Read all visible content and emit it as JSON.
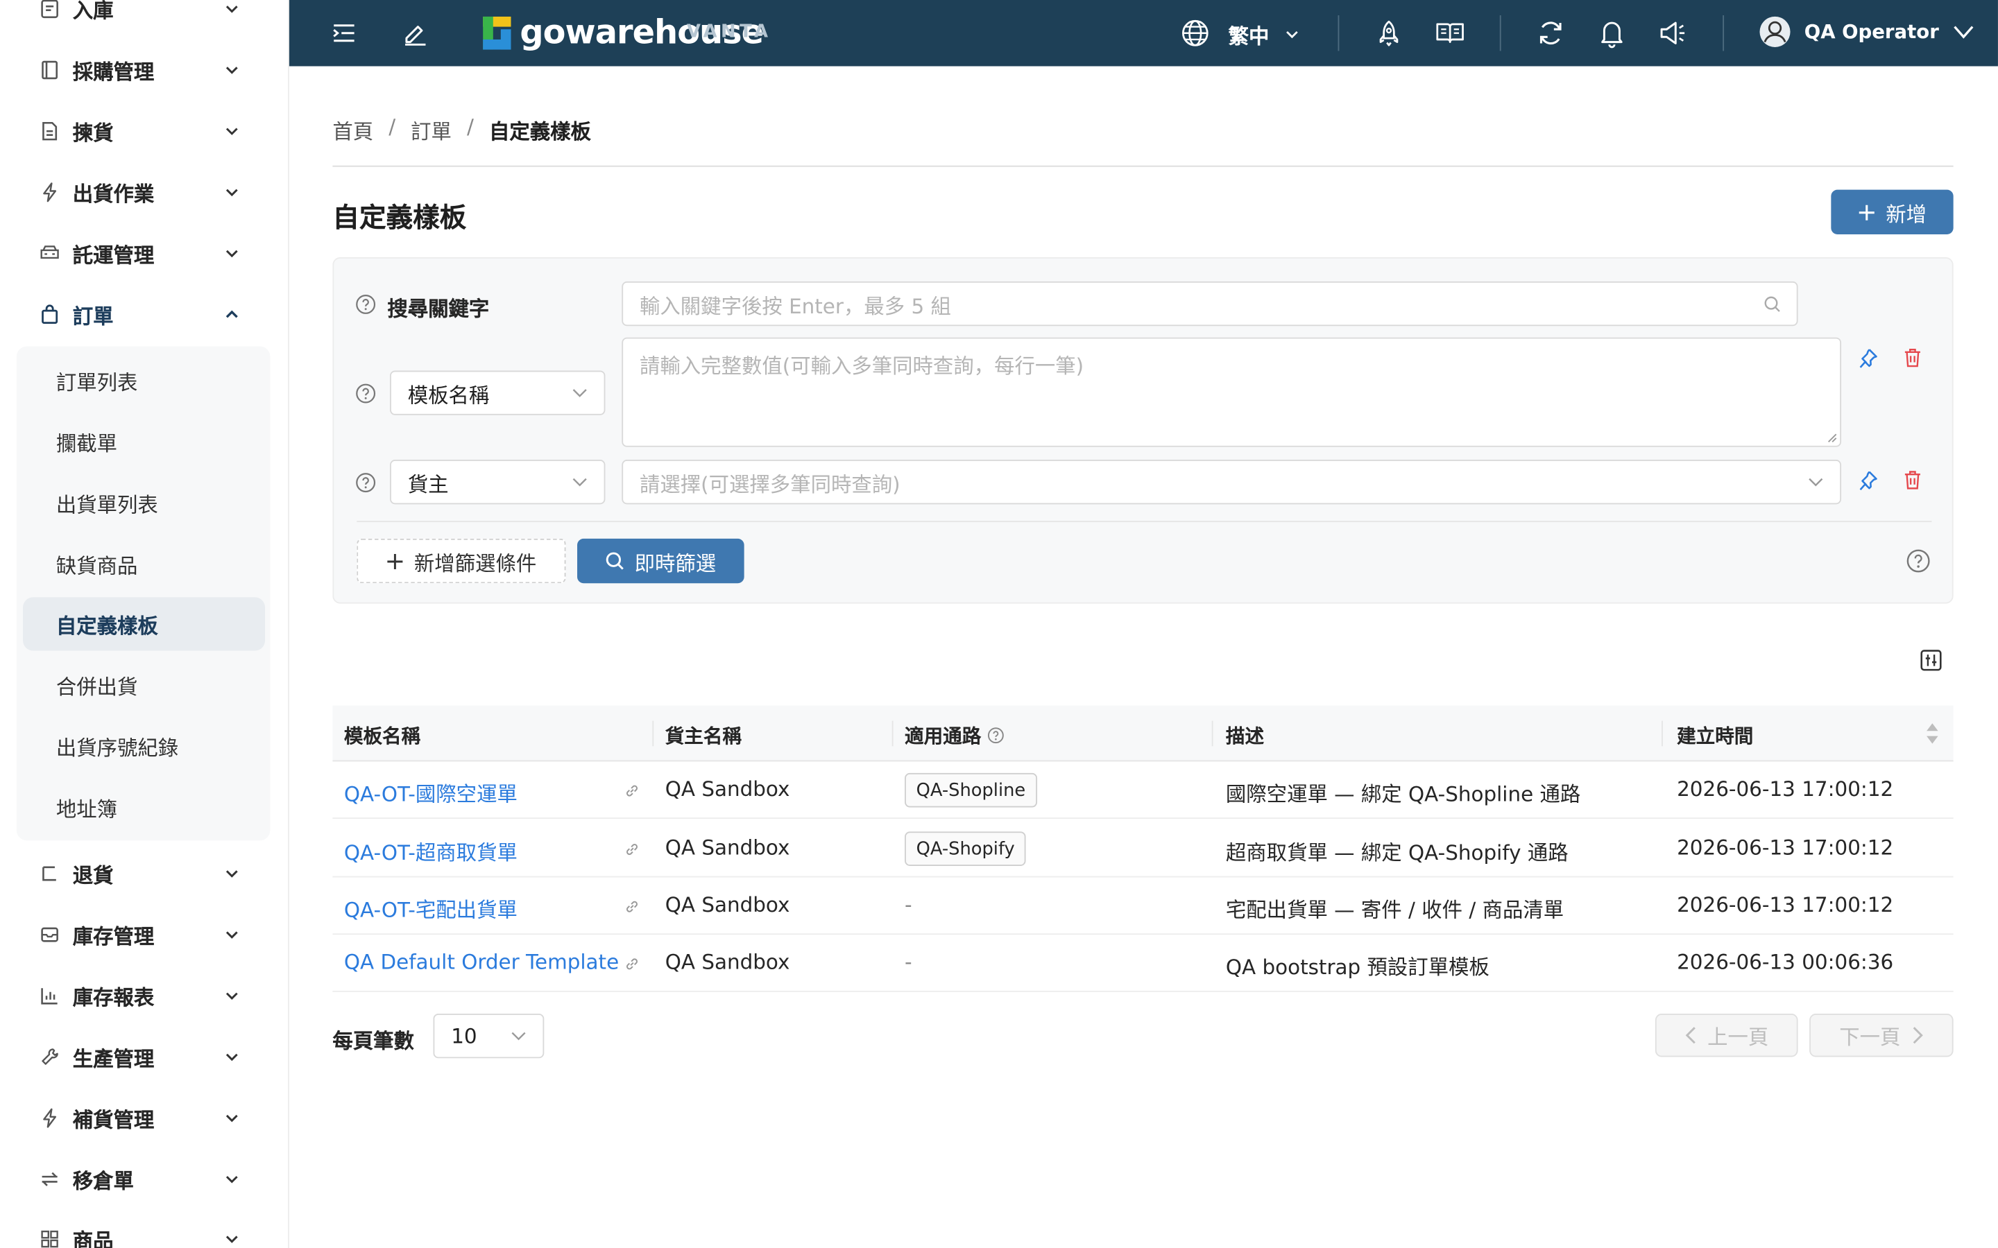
{
  "sidebar": {
    "items": [
      {
        "label": "入庫",
        "icon": "inbound-icon"
      },
      {
        "label": "採購管理",
        "icon": "document-icon"
      },
      {
        "label": "揀貨",
        "icon": "file-list-icon"
      },
      {
        "label": "出貨作業",
        "icon": "lightning-icon"
      },
      {
        "label": "託運管理",
        "icon": "truck-icon"
      },
      {
        "label": "訂單",
        "icon": "shopping-bag-icon"
      },
      {
        "label": "退貨",
        "icon": "return-icon"
      },
      {
        "label": "庫存管理",
        "icon": "inbox-icon"
      },
      {
        "label": "庫存報表",
        "icon": "bar-chart-icon"
      },
      {
        "label": "生產管理",
        "icon": "wrench-icon"
      },
      {
        "label": "補貨管理",
        "icon": "lightning-icon"
      },
      {
        "label": "移倉單",
        "icon": "swap-icon"
      },
      {
        "label": "商品",
        "icon": "grid-icon"
      }
    ],
    "order_submenu": [
      "訂單列表",
      "攔截單",
      "出貨單列表",
      "缺貨商品",
      "自定義樣板",
      "合併出貨",
      "出貨序號紀錄",
      "地址簿"
    ]
  },
  "topbar": {
    "logo_text": "gowarehouse",
    "logo_sub": "VANTA",
    "language": "繁中",
    "user_name": "QA Operator",
    "colors": {
      "bar": "#1e4057",
      "logo_yellow": "#f2c31a",
      "logo_green": "#39b54a",
      "logo_blue": "#2a8fd8"
    }
  },
  "breadcrumb": [
    "首頁",
    "訂單",
    "自定義樣板"
  ],
  "page": {
    "title": "自定義樣板",
    "add_button": "新增"
  },
  "filters": {
    "keyword_label": "搜尋關鍵字",
    "keyword_placeholder": "輸入關鍵字後按 Enter，最多 5 組",
    "field1_select": "模板名稱",
    "field1_placeholder": "請輸入完整數值(可輸入多筆同時查詢，每行一筆)",
    "field2_select": "貨主",
    "field2_placeholder": "請選擇(可選擇多筆同時查詢)",
    "add_condition": "新增篩選條件",
    "instant_filter": "即時篩選"
  },
  "table": {
    "headers": [
      "模板名稱",
      "貨主名稱",
      "適用通路",
      "描述",
      "建立時間"
    ],
    "rows": [
      {
        "name": "QA-OT-國際空運單",
        "owner": "QA Sandbox",
        "channel": "QA-Shopline",
        "desc": "國際空運單 — 綁定 QA-Shopline 通路",
        "created": "2026-06-13 17:00:12"
      },
      {
        "name": "QA-OT-超商取貨單",
        "owner": "QA Sandbox",
        "channel": "QA-Shopify",
        "desc": "超商取貨單 — 綁定 QA-Shopify 通路",
        "created": "2026-06-13 17:00:12"
      },
      {
        "name": "QA-OT-宅配出貨單",
        "owner": "QA Sandbox",
        "channel": "-",
        "desc": "宅配出貨單 — 寄件 / 收件 / 商品清單",
        "created": "2026-06-13 17:00:12"
      },
      {
        "name": "QA Default Order Template",
        "owner": "QA Sandbox",
        "channel": "-",
        "desc": "QA bootstrap 預設訂單模板",
        "created": "2026-06-13 00:06:36"
      }
    ]
  },
  "pagination": {
    "page_size_label": "每頁筆數",
    "page_size": "10",
    "prev": "上一頁",
    "next": "下一頁"
  }
}
